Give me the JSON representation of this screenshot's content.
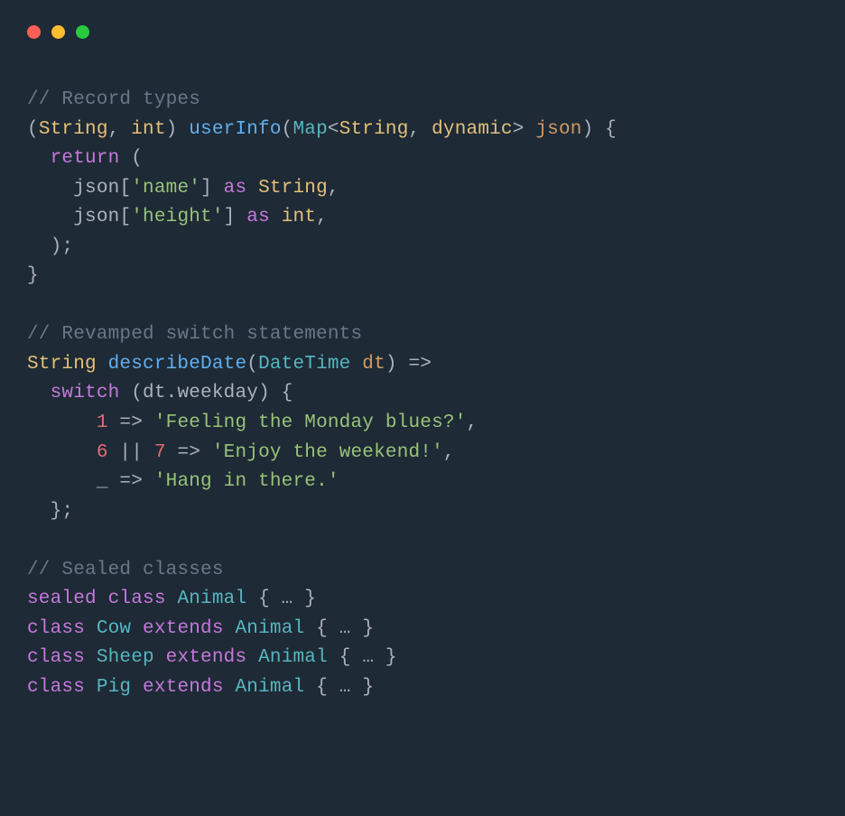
{
  "code": {
    "comment1": "// Record types",
    "line2": {
      "type1": "String",
      "type2": "int",
      "func": "userInfo",
      "maptype": "Map",
      "generic1": "String",
      "generic2": "dynamic",
      "param": "json"
    },
    "line3": {
      "keyword": "return"
    },
    "line4": {
      "obj": "json",
      "key": "'name'",
      "as": "as",
      "type": "String"
    },
    "line5": {
      "obj": "json",
      "key": "'height'",
      "as": "as",
      "type": "int"
    },
    "comment2": "// Revamped switch statements",
    "line9": {
      "type": "String",
      "func": "describeDate",
      "paramtype": "DateTime",
      "param": "dt"
    },
    "line10": {
      "switch": "switch",
      "obj": "dt",
      "prop": "weekday"
    },
    "line11": {
      "num": "1",
      "str": "'Feeling the Monday blues?'"
    },
    "line12": {
      "num1": "6",
      "num2": "7",
      "str": "'Enjoy the weekend!'"
    },
    "line13": {
      "underscore": "_",
      "str": "'Hang in there.'"
    },
    "comment3": "// Sealed classes",
    "line16": {
      "sealed": "sealed",
      "class": "class",
      "name": "Animal",
      "body": "{ … }"
    },
    "line17": {
      "class": "class",
      "name": "Cow",
      "extends": "extends",
      "parent": "Animal",
      "body": "{ … }"
    },
    "line18": {
      "class": "class",
      "name": "Sheep",
      "extends": "extends",
      "parent": "Animal",
      "body": "{ … }"
    },
    "line19": {
      "class": "class",
      "name": "Pig",
      "extends": "extends",
      "parent": "Animal",
      "body": "{ … }"
    }
  }
}
